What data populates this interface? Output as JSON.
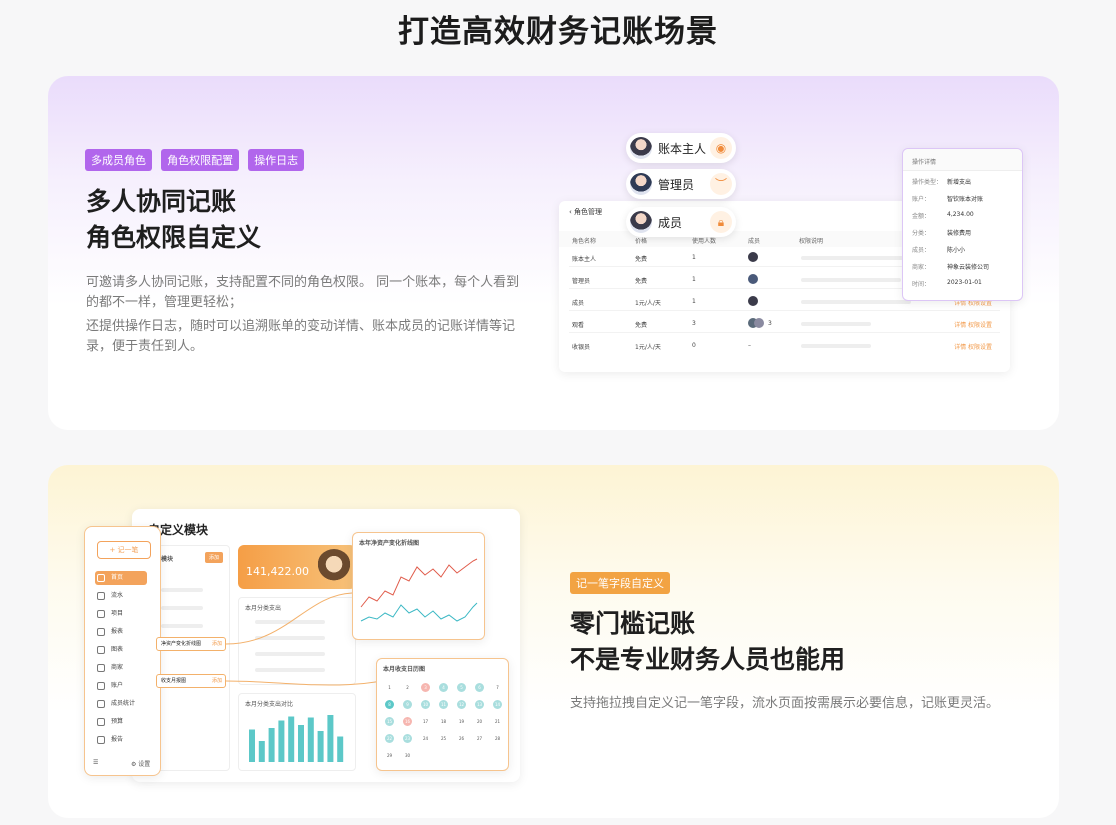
{
  "page": {
    "heading": "打造高效财务记账场景"
  },
  "section1": {
    "tags": [
      "多成员角色",
      "角色权限配置",
      "操作日志"
    ],
    "title_line1": "多人协同记账",
    "title_line2": "角色权限自定义",
    "desc1": "可邀请多人协同记账，支持配置不同的角色权限。 同一个账本，每个人看到的都不一样，管理更轻松；",
    "desc2": "还提供操作日志，随时可以追溯账单的变动详情、账本成员的记账详情等记录，便于责任到人。",
    "pills": [
      {
        "label": "账本主人",
        "icon": "eye-icon"
      },
      {
        "label": "管理员",
        "icon": "eye-closed-icon"
      },
      {
        "label": "成员",
        "icon": "lock-icon"
      }
    ],
    "role_panel": {
      "title": "角色管理",
      "columns": [
        "角色名称",
        "价格",
        "使用人数",
        "成员",
        "权限说明"
      ],
      "rows": [
        {
          "name": "账本主人",
          "price": "免费",
          "count": "1",
          "actions": ""
        },
        {
          "name": "管理员",
          "price": "免费",
          "count": "1",
          "actions": ""
        },
        {
          "name": "成员",
          "price": "1元/人/天",
          "count": "1",
          "actions": "详情  权限设置"
        },
        {
          "name": "观看",
          "price": "免费",
          "count": "3",
          "actions": "详情  权限设置"
        },
        {
          "name": "收银员",
          "price": "1元/人/天",
          "count": "0",
          "actions": "详情  权限设置"
        }
      ],
      "member_extra": "3",
      "member_dash": "–"
    },
    "log_panel": {
      "title": "操作详情",
      "items": [
        {
          "k": "操作类型：",
          "v": "新增支出"
        },
        {
          "k": "账户：",
          "v": "智钦账本对账"
        },
        {
          "k": "金额：",
          "v": "4,234.00"
        },
        {
          "k": "分类：",
          "v": "装修费用"
        },
        {
          "k": "成员：",
          "v": "陈小小"
        },
        {
          "k": "商家：",
          "v": "神象云装修公司"
        },
        {
          "k": "时间：",
          "v": "2023-01-01"
        }
      ]
    }
  },
  "section2": {
    "tag": "记一笔字段自定义",
    "title_line1": "零门槛记账",
    "title_line2": "不是专业财务人员也能用",
    "desc": "支持拖拉拽自定义记一笔字段，流水页面按需展示必要信息，记账更灵活。",
    "app": {
      "new_button": "+ 记一笔",
      "sidebar": [
        "首页",
        "流水",
        "项目",
        "报表",
        "图表",
        "商家",
        "账户",
        "成员统计",
        "预算",
        "报告"
      ],
      "settings": "设置",
      "panel_title": "自定义模块",
      "module_label": "模块",
      "module_btn": "添加",
      "amount": "141,422.00",
      "chart1_title": "本月分类支出",
      "chart2_title": "本月分类支出对比",
      "link1": "净资产变化折线图",
      "link2": "收支月报图",
      "link_action": "添加",
      "line_chart_title": "本年净资产变化折线图",
      "calendar_title": "本月收支日历图"
    },
    "chart_data": {
      "type": "bar",
      "categories": [
        "1",
        "2",
        "3",
        "4",
        "5",
        "6",
        "7",
        "8",
        "9",
        "10"
      ],
      "values": [
        6.5,
        4.2,
        6.8,
        8.3,
        9.1,
        7.4,
        8.9,
        6.2,
        9.4,
        5.1
      ],
      "title": "本月分类支出对比"
    },
    "calendar": {
      "days": [
        "1",
        "2",
        "3",
        "4",
        "5",
        "6",
        "7",
        "8",
        "9",
        "10",
        "11",
        "12",
        "13",
        "14",
        "15",
        "16",
        "17",
        "18",
        "19",
        "20",
        "21",
        "22",
        "23",
        "24",
        "25",
        "26",
        "27",
        "28",
        "29",
        "30"
      ]
    }
  }
}
